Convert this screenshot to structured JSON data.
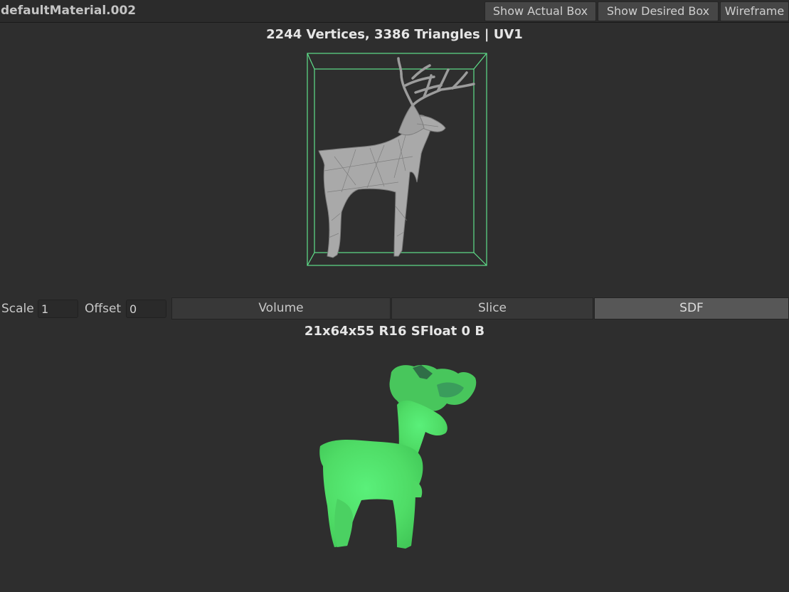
{
  "toolbar": {
    "material_name": "defaultMaterial.002",
    "show_actual_box": "Show Actual Box",
    "show_desired_box": "Show Desired Box",
    "wireframe": "Wireframe"
  },
  "mesh_preview": {
    "stats": "2244 Vertices, 3386 Triangles | UV1",
    "bounds_color": "#5fe08a",
    "mesh_color": "#a9a9a9"
  },
  "controls": {
    "scale_label": "Scale",
    "scale_value": "1",
    "offset_label": "Offset",
    "offset_value": "0",
    "tabs": [
      "Volume",
      "Slice",
      "SDF"
    ],
    "selected_tab": "SDF"
  },
  "sdf_preview": {
    "texture_info": "21x64x55 R16 SFloat 0 B",
    "sdf_color": "#54e06a"
  }
}
